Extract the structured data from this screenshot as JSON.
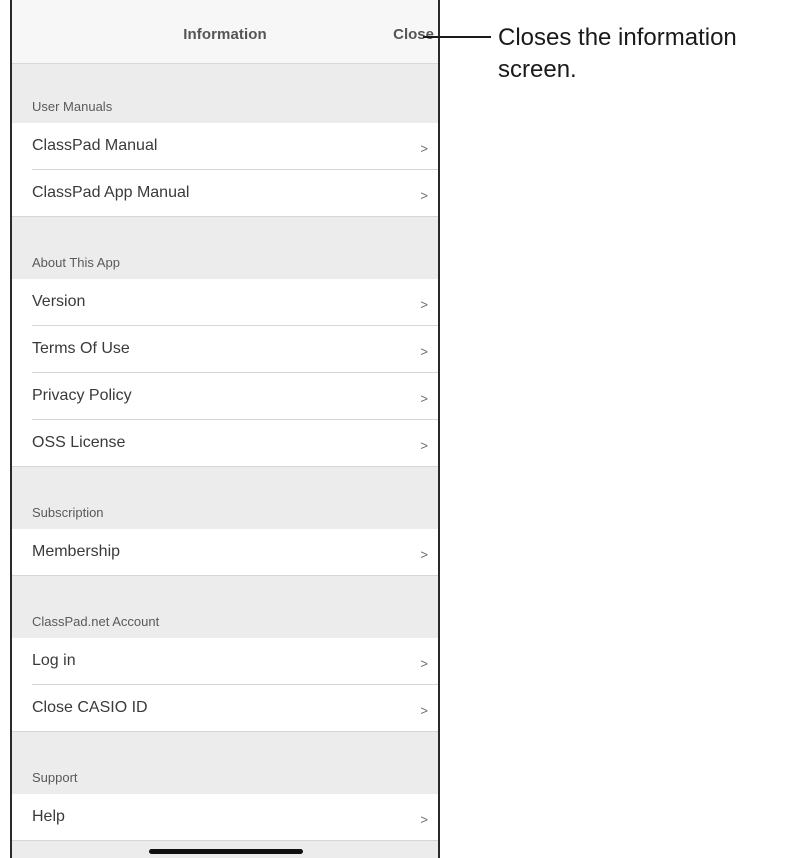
{
  "navbar": {
    "title": "Information",
    "close_label": "Close"
  },
  "sections": [
    {
      "header": "User Manuals",
      "items": [
        {
          "label": "ClassPad Manual",
          "chevron": ">"
        },
        {
          "label": "ClassPad App Manual",
          "chevron": ">"
        }
      ]
    },
    {
      "header": "About This App",
      "items": [
        {
          "label": "Version",
          "chevron": ">"
        },
        {
          "label": "Terms Of Use",
          "chevron": ">"
        },
        {
          "label": "Privacy Policy",
          "chevron": ">"
        },
        {
          "label": "OSS License",
          "chevron": ">"
        }
      ]
    },
    {
      "header": "Subscription",
      "items": [
        {
          "label": "Membership",
          "chevron": ">"
        }
      ]
    },
    {
      "header": "ClassPad.net Account",
      "items": [
        {
          "label": "Log in",
          "chevron": ">"
        },
        {
          "label": "Close CASIO ID",
          "chevron": ">"
        }
      ]
    },
    {
      "header": "Support",
      "items": [
        {
          "label": "Help",
          "chevron": ">"
        }
      ]
    }
  ],
  "callout": {
    "text": "Closes the information screen."
  }
}
